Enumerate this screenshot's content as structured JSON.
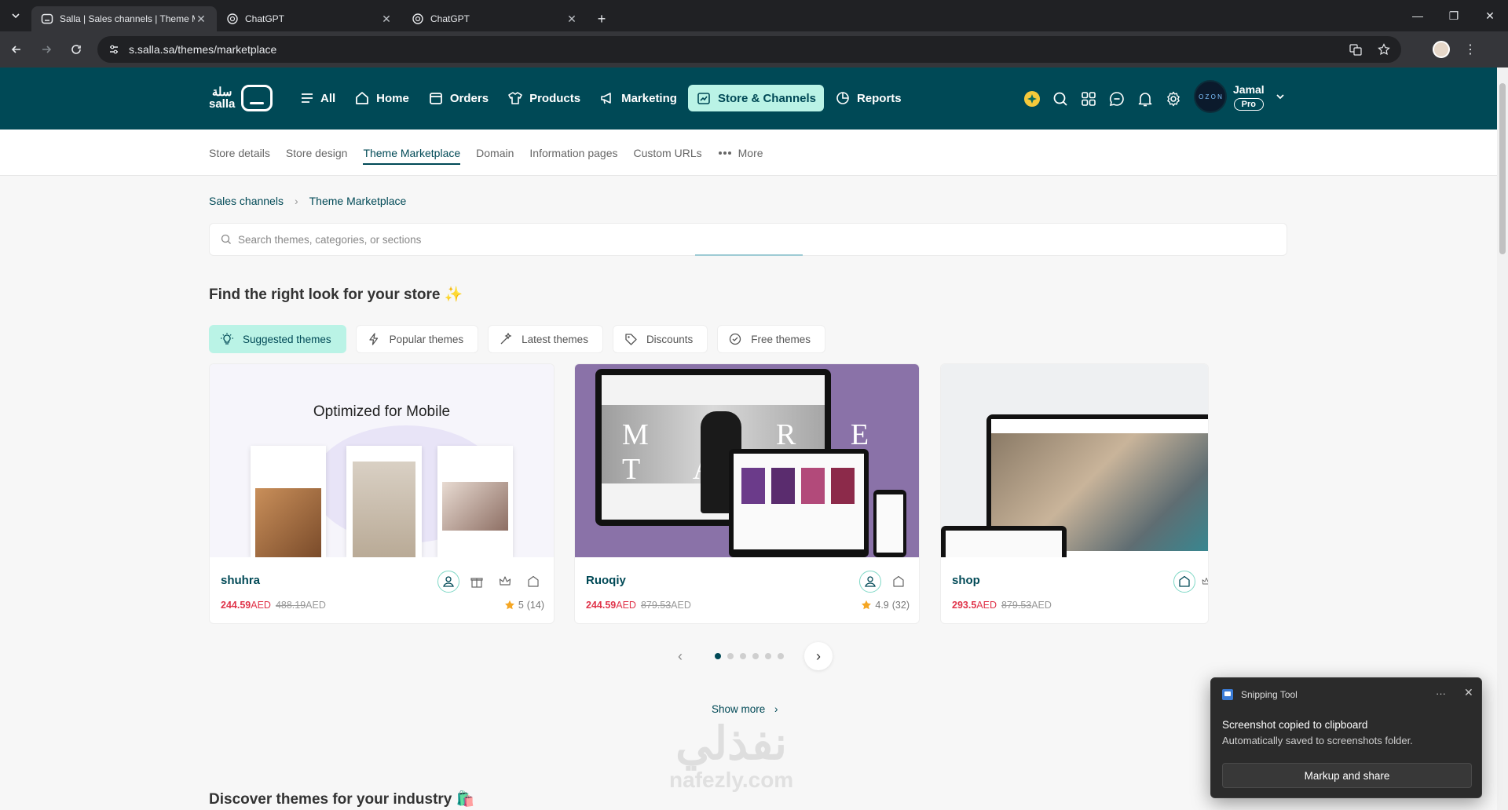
{
  "browser": {
    "tabs": [
      {
        "title": "Salla | Sales channels | Theme M",
        "active": true
      },
      {
        "title": "ChatGPT",
        "active": false
      },
      {
        "title": "ChatGPT",
        "active": false
      }
    ],
    "url": "s.salla.sa/themes/marketplace"
  },
  "header": {
    "logo_text_ar": "سلة",
    "logo_text_en": "salla",
    "nav": [
      {
        "label": "All",
        "icon": "menu-icon"
      },
      {
        "label": "Home",
        "icon": "home-icon"
      },
      {
        "label": "Orders",
        "icon": "orders-icon"
      },
      {
        "label": "Products",
        "icon": "shirt-icon"
      },
      {
        "label": "Marketing",
        "icon": "megaphone-icon"
      },
      {
        "label": "Store & Channels",
        "icon": "store-icon",
        "active": true
      },
      {
        "label": "Reports",
        "icon": "chart-icon"
      }
    ],
    "user": {
      "name": "Jamal",
      "plan": "Pro",
      "avatar_text": "O Z O N"
    }
  },
  "subnav": {
    "items": [
      {
        "label": "Store details"
      },
      {
        "label": "Store design"
      },
      {
        "label": "Theme Marketplace",
        "active": true
      },
      {
        "label": "Domain"
      },
      {
        "label": "Information pages"
      },
      {
        "label": "Custom URLs"
      },
      {
        "label": "More"
      }
    ]
  },
  "breadcrumb": {
    "parent": "Sales channels",
    "current": "Theme Marketplace"
  },
  "search": {
    "placeholder": "Search themes, categories, or sections"
  },
  "section1": {
    "title": "Find the right look for your store ✨"
  },
  "filters": [
    {
      "label": "Suggested themes",
      "active": true
    },
    {
      "label": "Popular themes"
    },
    {
      "label": "Latest themes"
    },
    {
      "label": "Discounts"
    },
    {
      "label": "Free themes"
    }
  ],
  "themes": [
    {
      "name": "shuhra",
      "price": "244.59",
      "old_price": "488.19",
      "currency": "AED",
      "rating": "5",
      "reviews": "(14)",
      "banner": "Optimized for Mobile"
    },
    {
      "name": "Ruoqiy",
      "price": "244.59",
      "old_price": "879.53",
      "currency": "AED",
      "rating": "4.9",
      "reviews": "(32)",
      "banner": "M A R E T A"
    },
    {
      "name": "shop",
      "price": "293.5",
      "old_price": "879.53",
      "currency": "AED"
    }
  ],
  "pager": {
    "pages": 6,
    "current": 1
  },
  "show_more": "Show more",
  "section2": {
    "title": "Discover themes for your industry 🛍️"
  },
  "watermark": {
    "ar": "نفذلي",
    "en": "nafezly.com"
  },
  "toast": {
    "app": "Snipping Tool",
    "line1": "Screenshot copied to clipboard",
    "line2": "Automatically saved to screenshots folder.",
    "button": "Markup and share"
  },
  "colors": {
    "brand": "#004956",
    "accent": "#baf3e6",
    "price": "#e0344a"
  }
}
